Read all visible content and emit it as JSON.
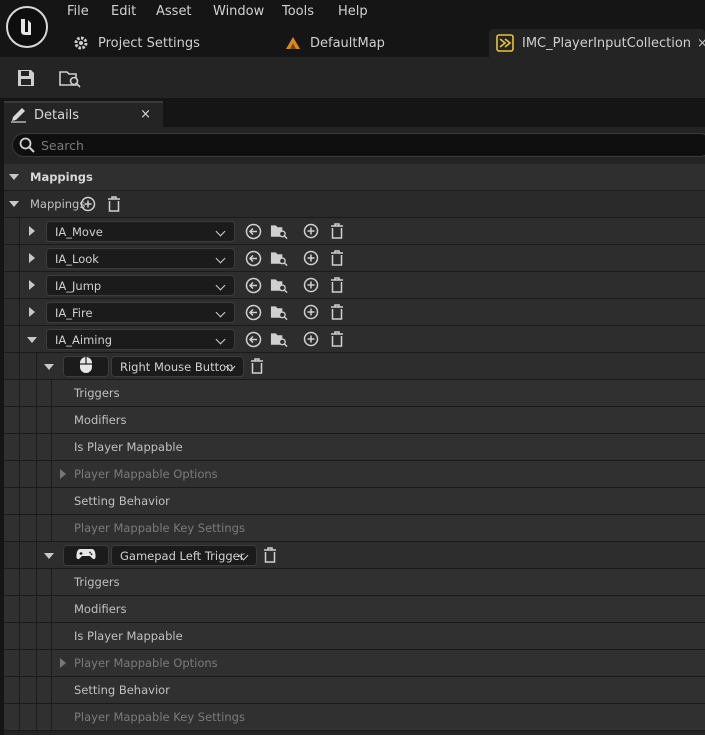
{
  "menu": [
    "File",
    "Edit",
    "Asset",
    "Window",
    "Tools",
    "Help"
  ],
  "tabs": [
    {
      "label": "Project Settings",
      "icon": "gear-icon"
    },
    {
      "label": "DefaultMap",
      "icon": "level-icon"
    },
    {
      "label": "IMC_PlayerInputCollection",
      "icon": "input-context-icon",
      "active": true
    }
  ],
  "tab_close": "×",
  "toolbar": {
    "save_icon": "save-icon",
    "browse_icon": "browse-asset-icon"
  },
  "details": {
    "title": "Details",
    "close": "×",
    "search_placeholder": "Search"
  },
  "category": {
    "label": "Mappings"
  },
  "mappings_array": {
    "label": "Mappings"
  },
  "actions": [
    {
      "name": "IA_Move",
      "expanded": false
    },
    {
      "name": "IA_Look",
      "expanded": false
    },
    {
      "name": "IA_Jump",
      "expanded": false
    },
    {
      "name": "IA_Fire",
      "expanded": false
    },
    {
      "name": "IA_Aiming",
      "expanded": true
    }
  ],
  "key_mappings": [
    {
      "key": "Right Mouse Button",
      "key_icon": "mouse-icon",
      "properties": [
        "Triggers",
        "Modifiers",
        "Is Player Mappable",
        "Player Mappable Options",
        "Setting Behavior",
        "Player Mappable Key Settings"
      ]
    },
    {
      "key": "Gamepad Left Trigger",
      "key_icon": "gamepad-icon",
      "properties": [
        "Triggers",
        "Modifiers",
        "Is Player Mappable",
        "Player Mappable Options",
        "Setting Behavior",
        "Player Mappable Key Settings"
      ]
    }
  ],
  "colors": {
    "background": "#151515",
    "panel": "#242424",
    "accent_yellow": "#e8c33a",
    "level_orange": "#d98a1c"
  }
}
